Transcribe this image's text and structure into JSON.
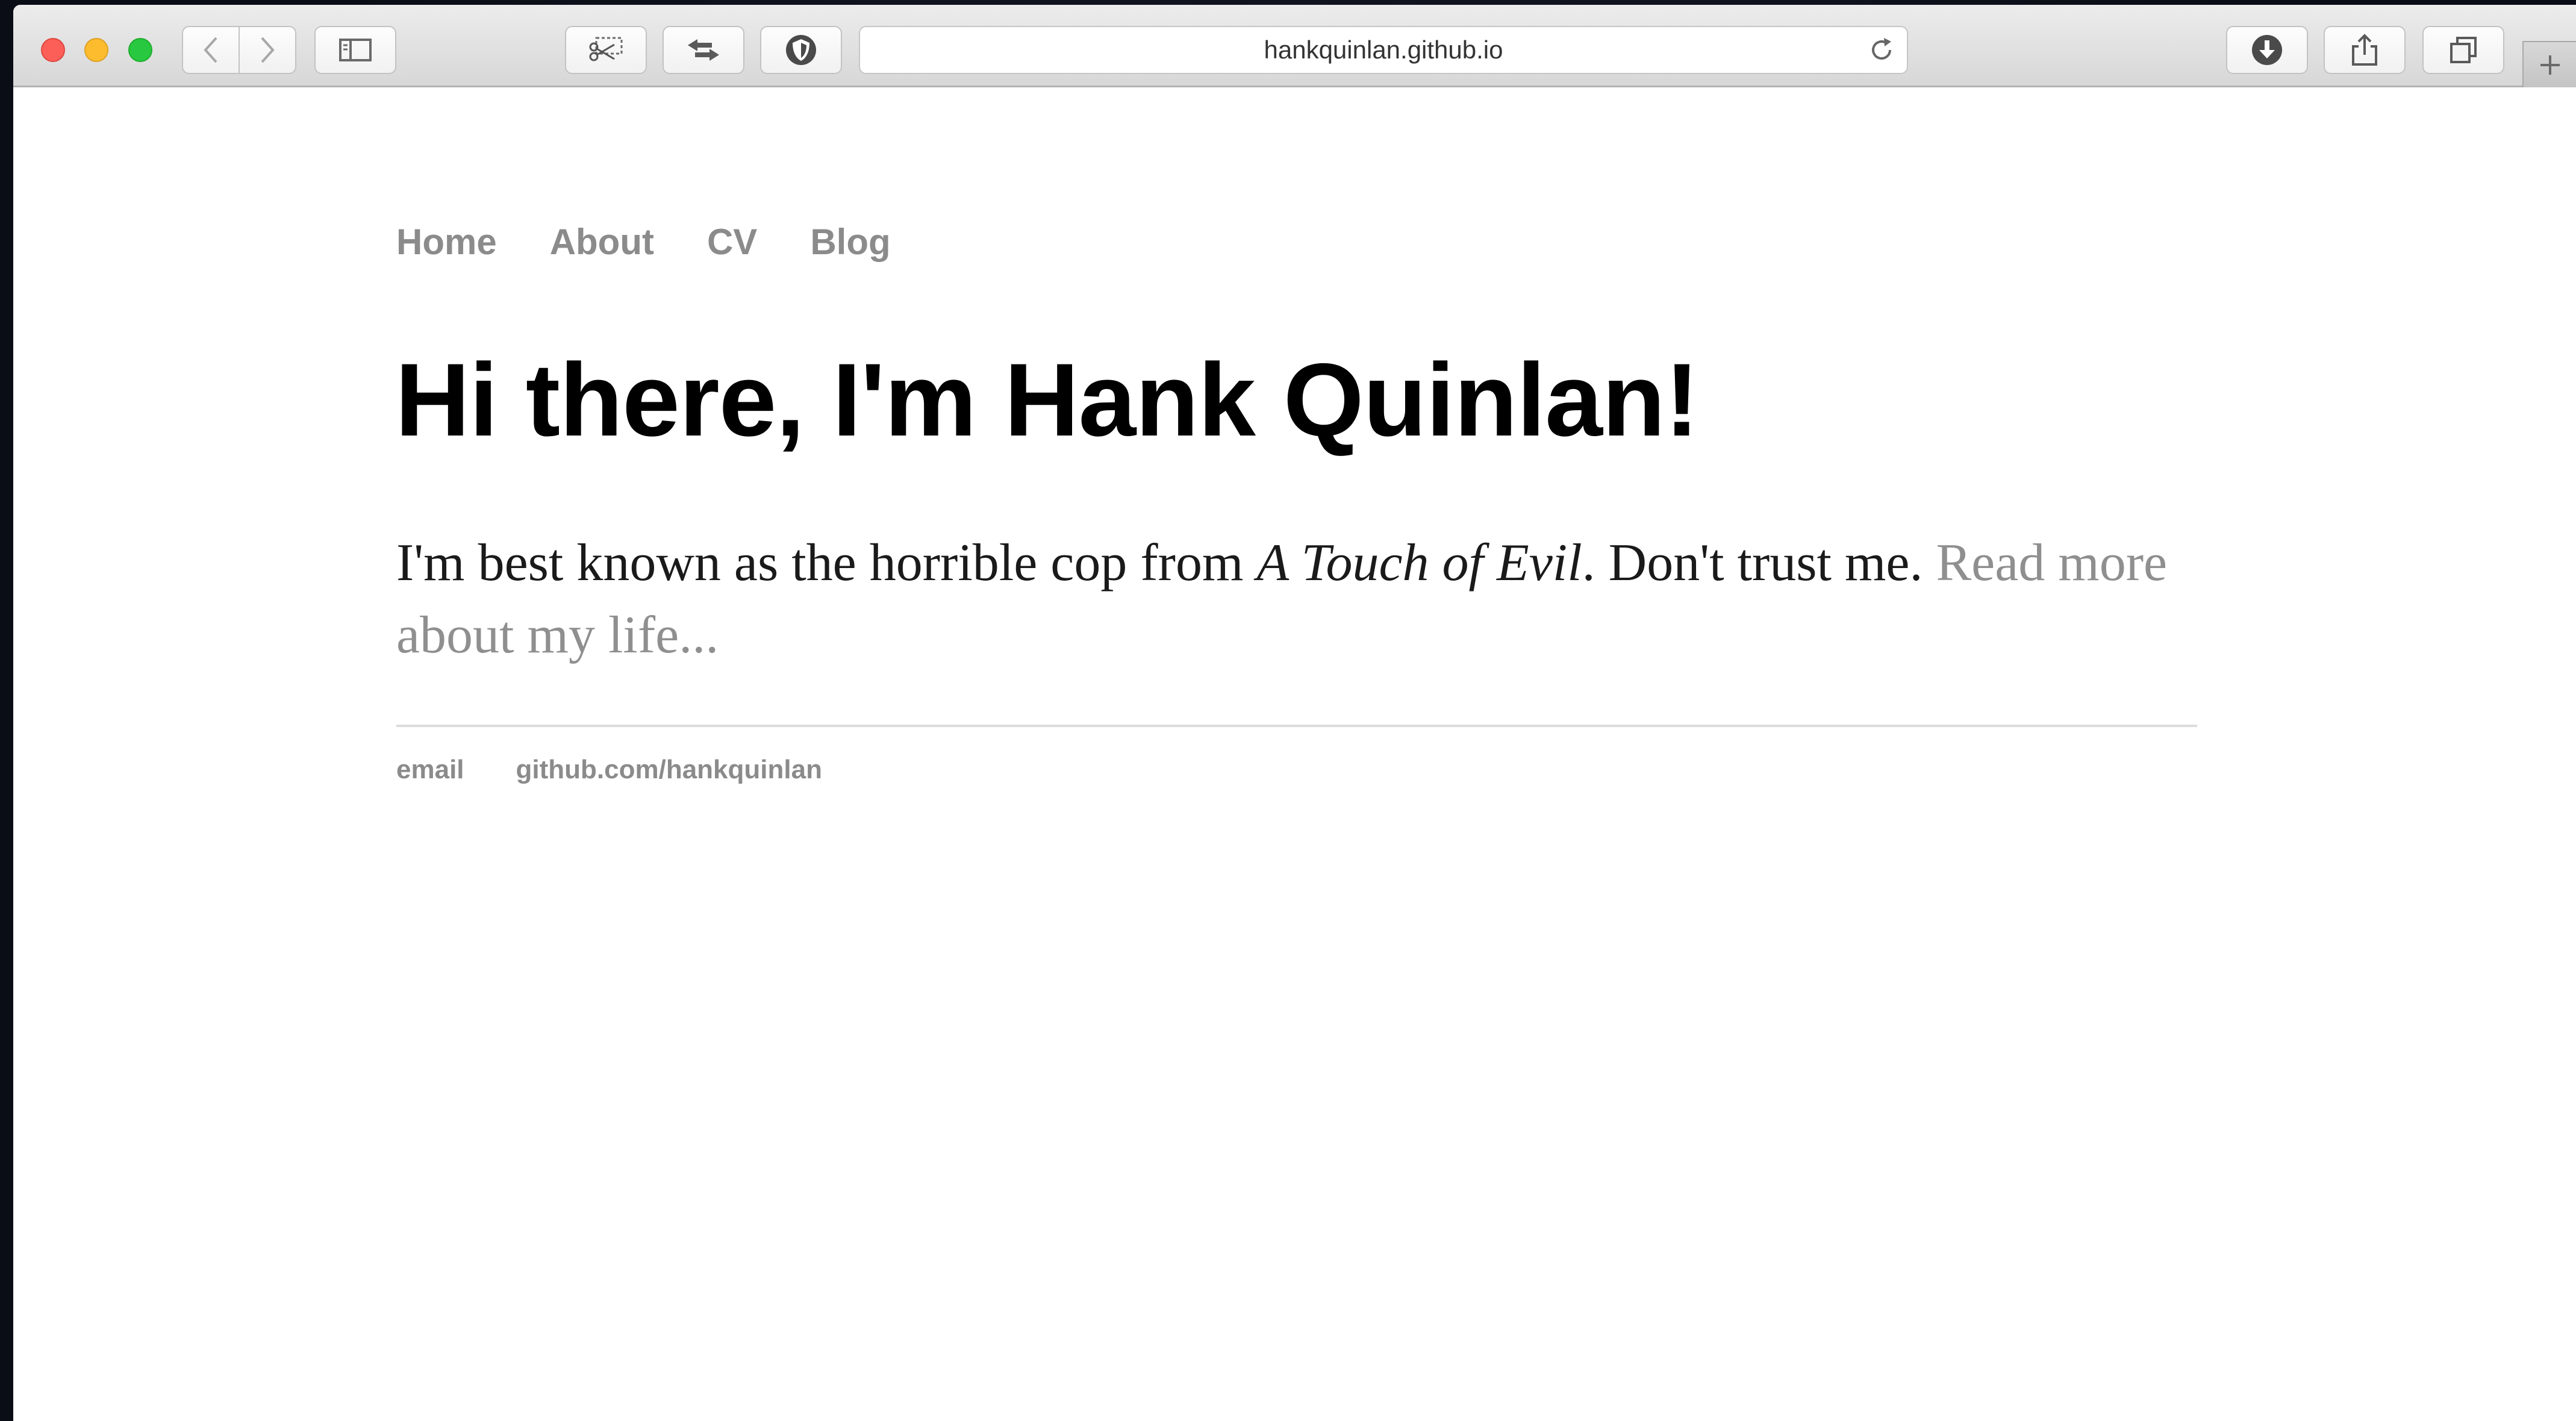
{
  "browser": {
    "address": "hankquinlan.github.io"
  },
  "nav": {
    "items": [
      {
        "label": "Home"
      },
      {
        "label": "About"
      },
      {
        "label": "CV"
      },
      {
        "label": "Blog"
      }
    ]
  },
  "main": {
    "headline": "Hi there, I'm Hank Quinlan!",
    "intro_before": "I'm best known as the horrible cop from ",
    "intro_title": "A Touch of Evil",
    "intro_after": ". Don't trust me. ",
    "read_more": "Read more about my life..."
  },
  "footer": {
    "links": [
      {
        "label": "email"
      },
      {
        "label": "github.com/hankquinlan"
      }
    ]
  },
  "icons": {
    "back": "chevron-left-icon",
    "forward": "chevron-right-icon",
    "sidebar": "sidebar-icon",
    "clip": "scissors-icon",
    "swap": "swap-arrows-icon",
    "privacy": "shield-icon",
    "reload": "reload-icon",
    "download": "download-icon",
    "share": "share-icon",
    "tabs": "tabs-overview-icon",
    "new_tab": "plus-icon"
  },
  "colors": {
    "nav_link": "#8b8b8b",
    "heading": "#000000",
    "body_text": "#1a1a1a",
    "muted_link": "#8f8f8f",
    "close": "#fc5f57",
    "minimize": "#fdbc2e",
    "maximize": "#28c940"
  }
}
